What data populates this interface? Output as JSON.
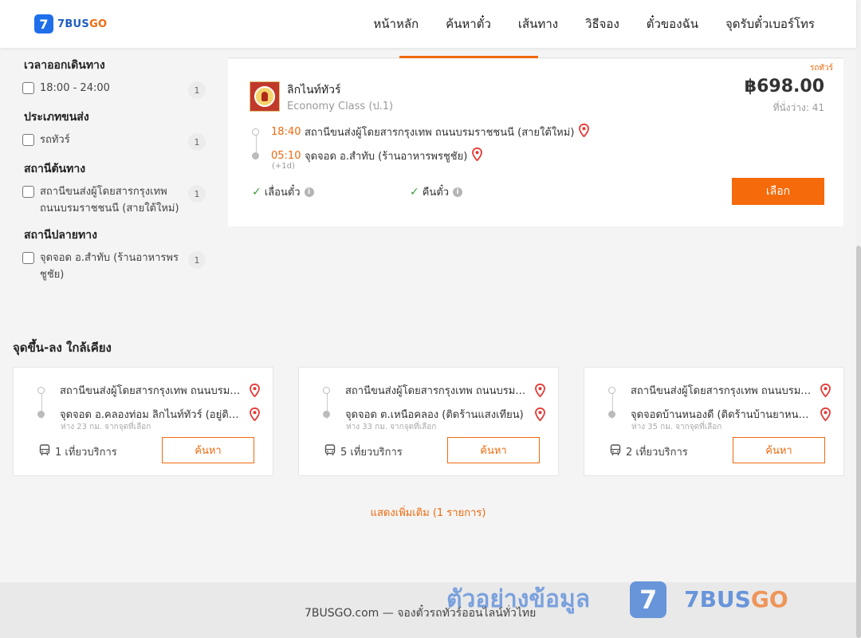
{
  "header": {
    "logo_number": "7",
    "logo_brand_a": "7BUS",
    "logo_brand_b": "GO",
    "nav": [
      "หน้าหลัก",
      "ค้นหาตั๋ว",
      "เส้นทาง",
      "วิธีจอง",
      "ตั๋วของฉัน",
      "จุดรับตั๋วเบอร์โทร"
    ]
  },
  "filters": {
    "departure_time": {
      "title": "เวลาออกเดินทาง",
      "option": "18:00 - 24:00",
      "count": "1"
    },
    "transport_type": {
      "title": "ประเภทขนส่ง",
      "option": "รถทัวร์",
      "count": "1"
    },
    "origin_station": {
      "title": "สถานีต้นทาง",
      "option": "สถานีขนส่งผู้โดยสารกรุงเทพ ถนนบรมราชชนนี (สายใต้ใหม่)",
      "count": "1"
    },
    "destination_station": {
      "title": "สถานีปลายทาง",
      "option": "จุดจอด อ.สำทับ (ร้านอาหารพรชูชัย)",
      "count": "1"
    }
  },
  "trip": {
    "bus_type_tag": "รถทัวร์",
    "operator": "ลิกไนท์ทัวร์",
    "class": "Economy Class (ป.1)",
    "price": "฿698.00",
    "seats_label": "ที่นั่งว่าง: 41",
    "depart_time": "18:40",
    "depart_station": "สถานีขนส่งผู้โดยสารกรุงเทพ ถนนบรมราชชนนี (สายใต้ใหม่)",
    "arrive_time": "05:10",
    "arrive_station": "จุดจอด อ.สำทับ (ร้านอาหารพรชูชัย)",
    "plus_day": "(+1d)",
    "policy_change": "เลื่อนตั๋ว",
    "policy_refund": "คืนตั๋ว",
    "select_label": "เลือก"
  },
  "nearby": {
    "title": "จุดขึ้น-ลง ใกล้เคียง",
    "cards": [
      {
        "from": "สถานีขนส่งผู้โดยสารกรุงเทพ ถนนบรมราชชนนี",
        "to": "จุดจอด อ.คลองท่อม ลิกไนท์ทัวร์ (อยู่ติดถนน)",
        "distance": "ห่าง 23 กม. จากจุดที่เลือก",
        "trips": "1 เที่ยวบริการ",
        "search_label": "ค้นหา"
      },
      {
        "from": "สถานีขนส่งผู้โดยสารกรุงเทพ ถนนบรมราชชนนี",
        "to": "จุดจอด ต.เหนือคลอง (ติดร้านแสงเทียน)",
        "distance": "ห่าง 33 กม. จากจุดที่เลือก",
        "trips": "5 เที่ยวบริการ",
        "search_label": "ค้นหา"
      },
      {
        "from": "สถานีขนส่งผู้โดยสารกรุงเทพ ถนนบรมราชชนนี",
        "to": "จุดจอดบ้านหนองดี (ติดร้านบ้านยาหนองดี)",
        "distance": "ห่าง 35 กม. จากจุดที่เลือก",
        "trips": "2 เที่ยวบริการ",
        "search_label": "ค้นหา"
      }
    ],
    "show_more": "แสดงเพิ่มเติม (1 รายการ)"
  },
  "footer": {
    "text": "7BUSGO.com — จองตั๋วรถทัวร์ออนไลน์ทั่วไทย"
  },
  "watermark": {
    "text": "ตัวอย่างข้อมูล",
    "logo_number": "7",
    "brand_a": "7BUS",
    "brand_b": "GO"
  },
  "colors": {
    "accent": "#f06a0e",
    "brand_blue": "#1f6feb"
  }
}
